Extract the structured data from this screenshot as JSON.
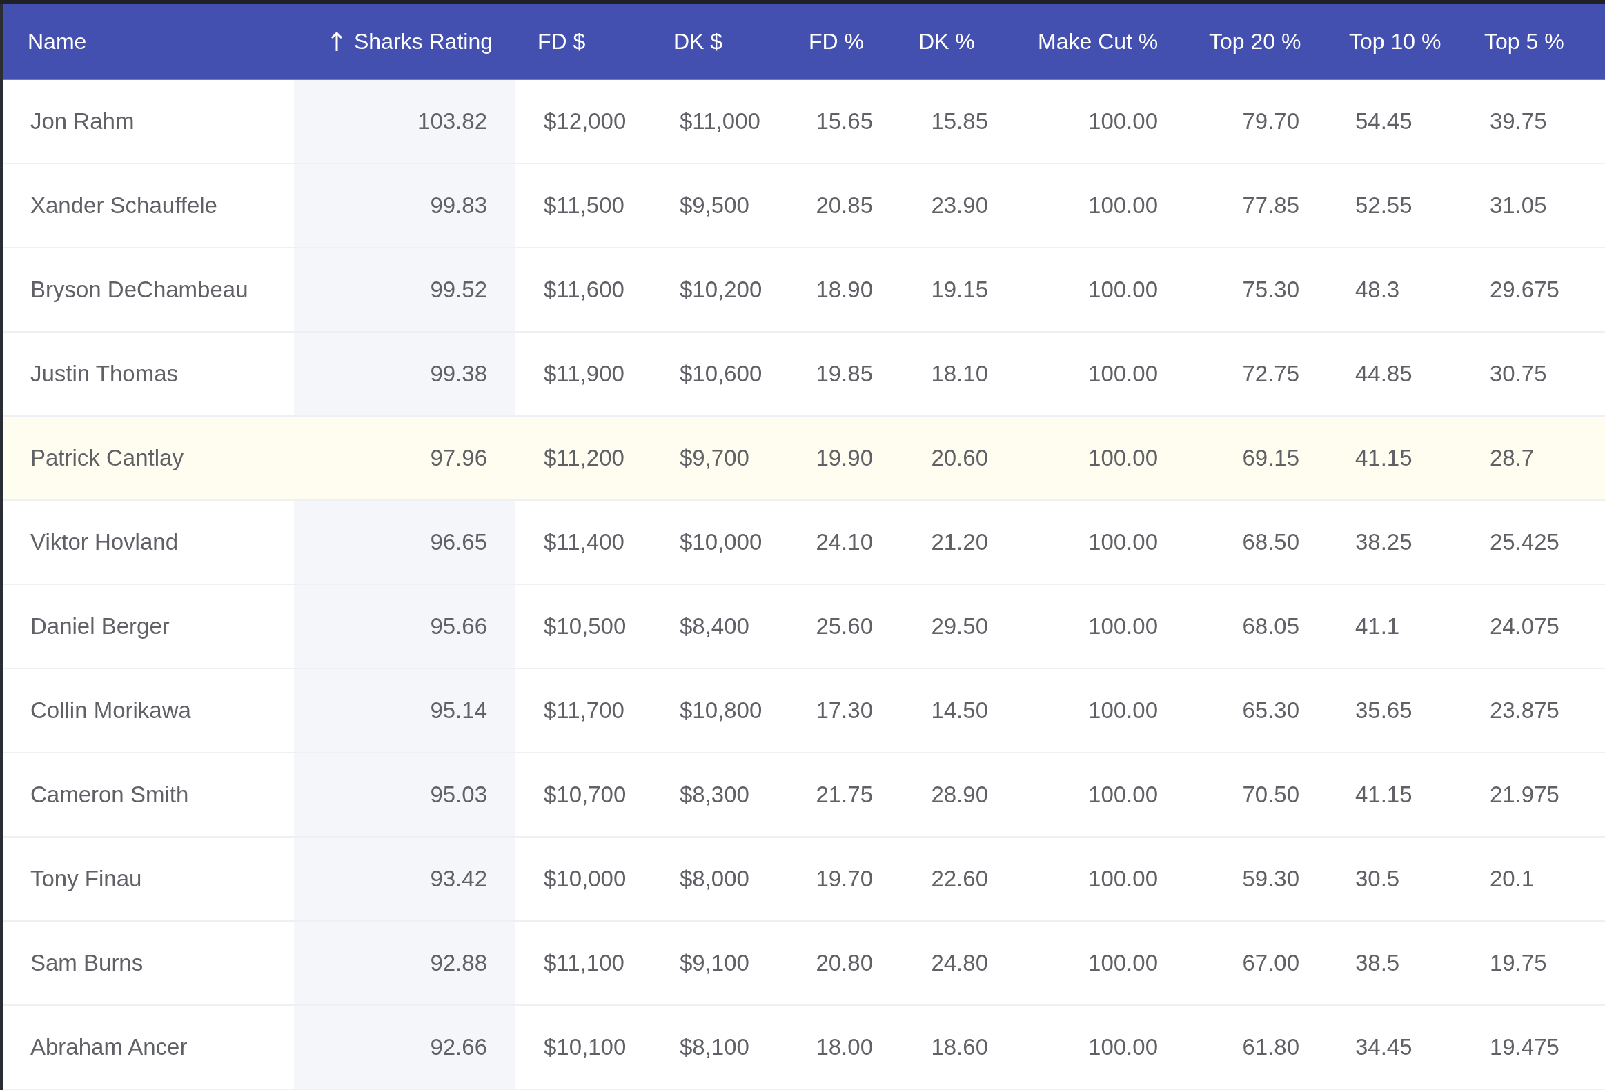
{
  "table": {
    "columns": [
      {
        "label": "Name",
        "sorted": false
      },
      {
        "label": "Sharks Rating",
        "sorted": true
      },
      {
        "label": "FD $",
        "sorted": false
      },
      {
        "label": "DK $",
        "sorted": false
      },
      {
        "label": "FD %",
        "sorted": false
      },
      {
        "label": "DK %",
        "sorted": false
      },
      {
        "label": "Make Cut %",
        "sorted": false
      },
      {
        "label": "Top 20 %",
        "sorted": false
      },
      {
        "label": "Top 10 %",
        "sorted": false
      },
      {
        "label": "Top 5 %",
        "sorted": false
      }
    ],
    "rows": [
      {
        "highlighted": false,
        "cells": [
          "Jon Rahm",
          "103.82",
          "$12,000",
          "$11,000",
          "15.65",
          "15.85",
          "100.00",
          "79.70",
          "54.45",
          "39.75"
        ]
      },
      {
        "highlighted": false,
        "cells": [
          "Xander Schauffele",
          "99.83",
          "$11,500",
          "$9,500",
          "20.85",
          "23.90",
          "100.00",
          "77.85",
          "52.55",
          "31.05"
        ]
      },
      {
        "highlighted": false,
        "cells": [
          "Bryson DeChambeau",
          "99.52",
          "$11,600",
          "$10,200",
          "18.90",
          "19.15",
          "100.00",
          "75.30",
          "48.3",
          "29.675"
        ]
      },
      {
        "highlighted": false,
        "cells": [
          "Justin Thomas",
          "99.38",
          "$11,900",
          "$10,600",
          "19.85",
          "18.10",
          "100.00",
          "72.75",
          "44.85",
          "30.75"
        ]
      },
      {
        "highlighted": true,
        "cells": [
          "Patrick Cantlay",
          "97.96",
          "$11,200",
          "$9,700",
          "19.90",
          "20.60",
          "100.00",
          "69.15",
          "41.15",
          "28.7"
        ]
      },
      {
        "highlighted": false,
        "cells": [
          "Viktor Hovland",
          "96.65",
          "$11,400",
          "$10,000",
          "24.10",
          "21.20",
          "100.00",
          "68.50",
          "38.25",
          "25.425"
        ]
      },
      {
        "highlighted": false,
        "cells": [
          "Daniel Berger",
          "95.66",
          "$10,500",
          "$8,400",
          "25.60",
          "29.50",
          "100.00",
          "68.05",
          "41.1",
          "24.075"
        ]
      },
      {
        "highlighted": false,
        "cells": [
          "Collin Morikawa",
          "95.14",
          "$11,700",
          "$10,800",
          "17.30",
          "14.50",
          "100.00",
          "65.30",
          "35.65",
          "23.875"
        ]
      },
      {
        "highlighted": false,
        "cells": [
          "Cameron Smith",
          "95.03",
          "$10,700",
          "$8,300",
          "21.75",
          "28.90",
          "100.00",
          "70.50",
          "41.15",
          "21.975"
        ]
      },
      {
        "highlighted": false,
        "cells": [
          "Tony Finau",
          "93.42",
          "$10,000",
          "$8,000",
          "19.70",
          "22.60",
          "100.00",
          "59.30",
          "30.5",
          "20.1"
        ]
      },
      {
        "highlighted": false,
        "cells": [
          "Sam Burns",
          "92.88",
          "$11,100",
          "$9,100",
          "20.80",
          "24.80",
          "100.00",
          "67.00",
          "38.5",
          "19.75"
        ]
      },
      {
        "highlighted": false,
        "cells": [
          "Abraham Ancer",
          "92.66",
          "$10,100",
          "$8,100",
          "18.00",
          "18.60",
          "100.00",
          "61.80",
          "34.45",
          "19.475"
        ]
      }
    ]
  }
}
